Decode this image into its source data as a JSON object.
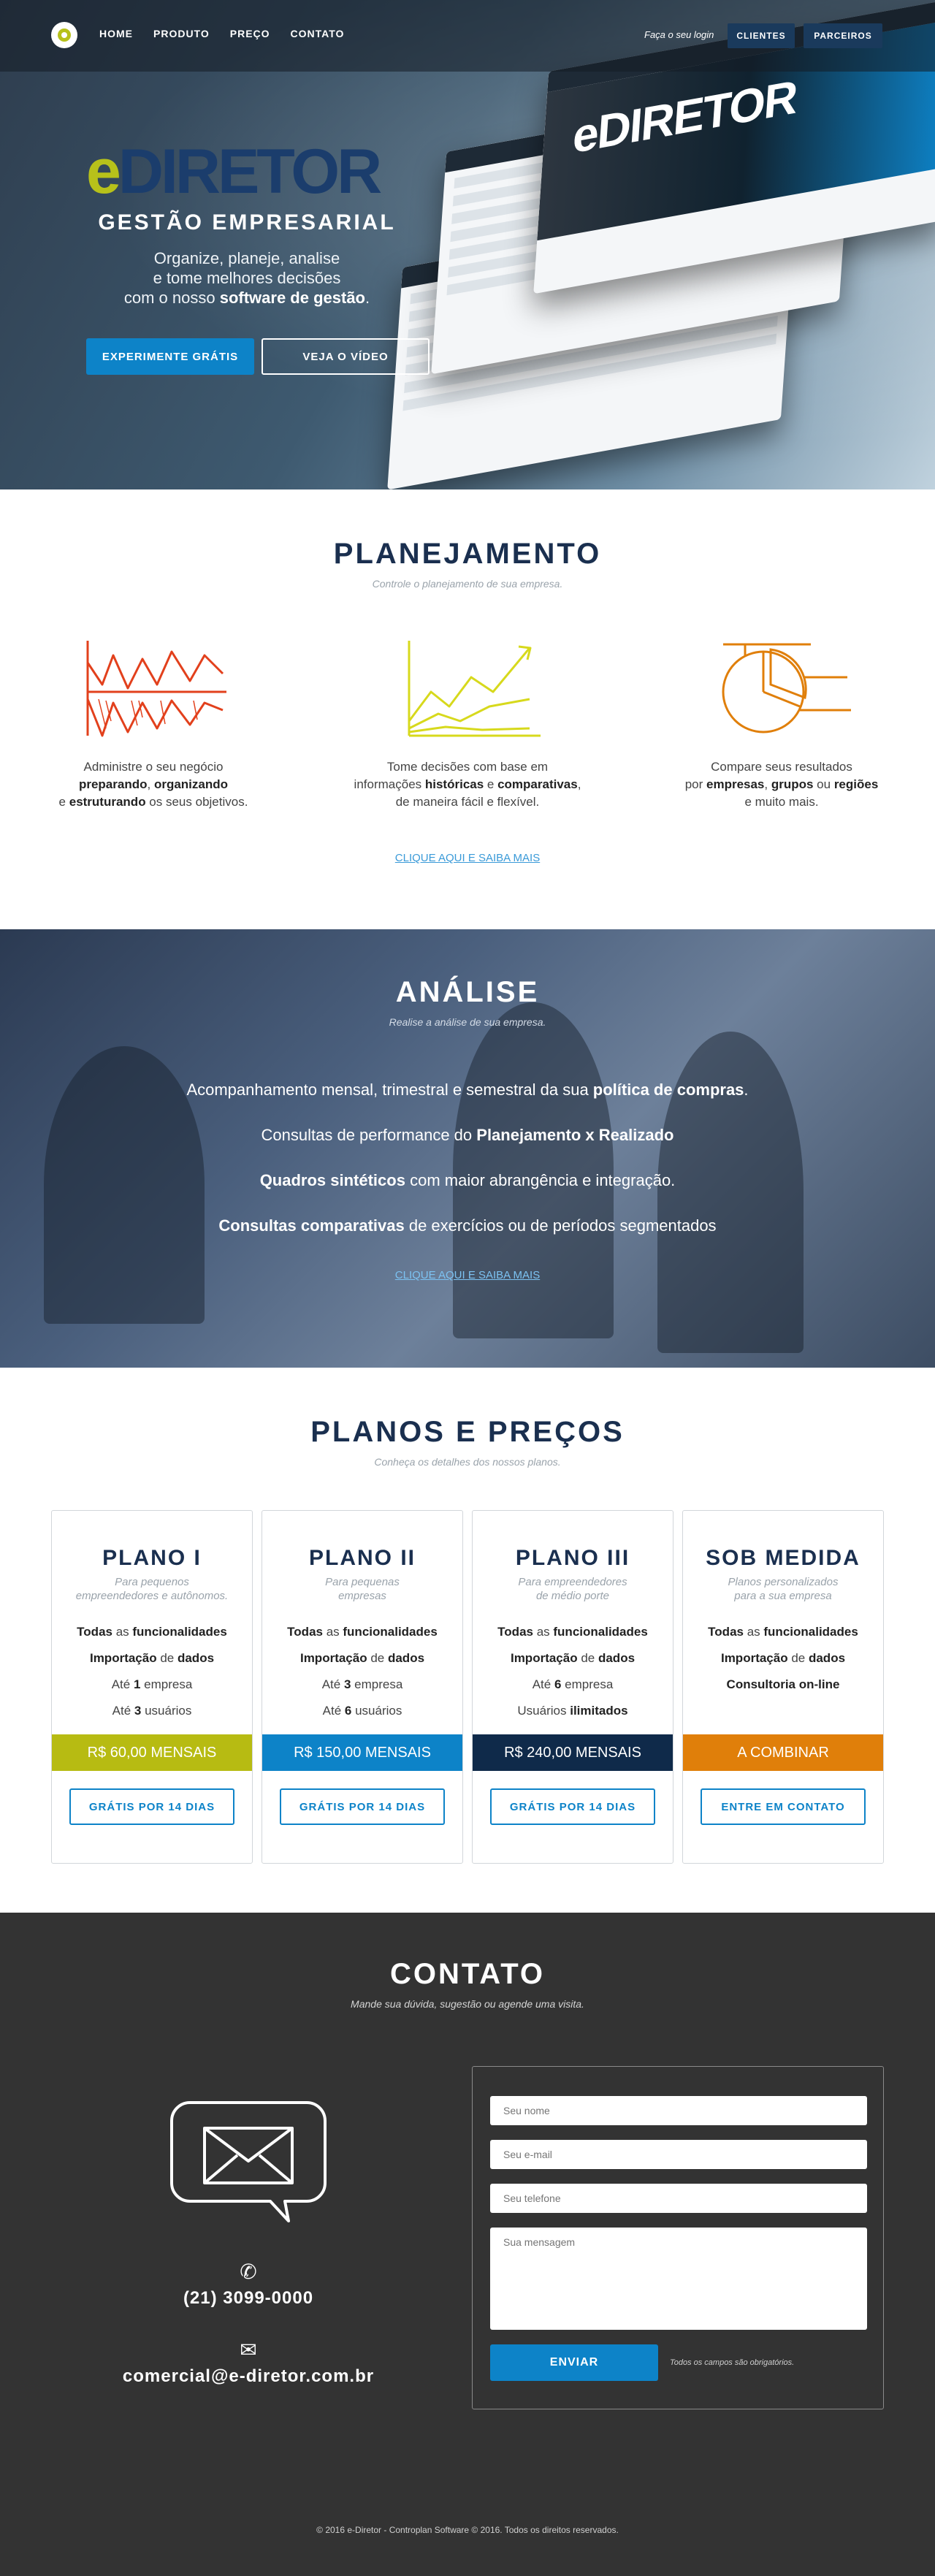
{
  "nav": {
    "items": [
      "HOME",
      "PRODUTO",
      "PREÇO",
      "CONTATO"
    ],
    "login_link": "Faça o seu login",
    "clientes": "CLIENTES",
    "parceiros": "PARCEIROS"
  },
  "hero": {
    "brand_e": "e",
    "brand_rest": "DIRETOR",
    "subtitle": "GESTÃO EMPRESARIAL",
    "line1": "Organize, planeje, analise",
    "line2": "e tome melhores decisões",
    "line3_pre": "com o nosso ",
    "line3_bold": "software de gestão",
    "line3_post": ".",
    "btn_primary": "EXPERIMENTE GRÁTIS",
    "btn_video": "VEJA O VÍDEO",
    "mockup_brand": "eDIRETOR"
  },
  "planejamento": {
    "title": "PLANEJAMENTO",
    "subtitle": "Controle o planejamento de sua empresa.",
    "features": [
      {
        "l1_pre": "Administre o seu negócio",
        "l2_b1": "preparando",
        "l2_mid": ", ",
        "l2_b2": "organizando",
        "l3_pre": "e ",
        "l3_b": "estruturando",
        "l3_post": " os seus objetivos."
      },
      {
        "l1_pre": "Tome decisões com base em",
        "l2_pre": "informações ",
        "l2_b1": "históricas",
        "l2_mid": " e ",
        "l2_b2": "comparativas",
        "l2_post": ",",
        "l3": "de maneira fácil e flexível."
      },
      {
        "l1_pre": "Compare seus resultados",
        "l2_pre": "por ",
        "l2_b1": "empresas",
        "l2_mid": ", ",
        "l2_b2": "grupos",
        "l2_mid2": " ou ",
        "l2_b3": "regiões",
        "l3": "e muito mais."
      }
    ],
    "link": "CLIQUE AQUI E SAIBA MAIS"
  },
  "analise": {
    "title": "ANÁLISE",
    "subtitle": "Realise a análise de sua empresa.",
    "l1_pre": "Acompanhamento mensal, trimestral e semestral da sua ",
    "l1_b": "política de compras",
    "l1_post": ".",
    "l2_pre": "Consultas de performance do ",
    "l2_b": "Planejamento x Realizado",
    "l3_b": "Quadros sintéticos",
    "l3_post": " com maior abrangência e integração.",
    "l4_b": "Consultas comparativas",
    "l4_post": " de exercícios ou de períodos segmentados",
    "link": "CLIQUE AQUI E SAIBA MAIS"
  },
  "planos": {
    "title": "PLANOS E PREÇOS",
    "subtitle": "Conheça os detalhes dos nossos planos.",
    "plans": [
      {
        "name": "PLANO I",
        "d1": "Para pequenos",
        "d2": "empreendedores e autônomos.",
        "price": "R$ 60,00 MENSAIS",
        "price_color": "#b7bb12",
        "button": "GRÁTIS POR 14 DIAS"
      },
      {
        "name": "PLANO II",
        "d1": "Para pequenas",
        "d2": "empresas",
        "price": "R$ 150,00 MENSAIS",
        "price_color": "#0d83c8",
        "button": "GRÁTIS POR 14 DIAS"
      },
      {
        "name": "PLANO III",
        "d1": "Para empreendedores",
        "d2": "de médio porte",
        "price": "R$ 240,00 MENSAIS",
        "price_color": "#0f2a4a",
        "button": "GRÁTIS POR 14 DIAS"
      },
      {
        "name": "SOB MEDIDA",
        "d1": "Planos personalizados",
        "d2": "para a sua empresa",
        "price": "A COMBINAR",
        "price_color": "#e07f0a",
        "button": "ENTRE EM CONTATO"
      }
    ],
    "f_todas": "Todas",
    "f_as": " as ",
    "f_func": "funcionalidades",
    "f_imp": "Importação",
    "f_de": " de ",
    "f_dados": "dados",
    "f_ate": "Até ",
    "p1_emp": "1",
    "p1_emp_t": " empresa",
    "p1_usr": "3",
    "p1_usr_t": " usuários",
    "p2_emp": "3",
    "p2_emp_t": " empresa",
    "p2_usr": "6",
    "p2_usr_t": " usuários",
    "p3_emp": "6",
    "p3_emp_t": " empresa",
    "p3_usr_pre": "Usuários ",
    "p3_usr_b": "ilimitados",
    "p4_consult": "Consultoria on-line"
  },
  "contato": {
    "title": "CONTATO",
    "subtitle": "Mande sua dúvida, sugestão ou agende uma visita.",
    "phone": "(21) 3099-0000",
    "email": "comercial@e-diretor.com.br",
    "ph_name": "Seu nome",
    "ph_email": "Seu e-mail",
    "ph_phone": "Seu telefone",
    "ph_message": "Sua mensagem",
    "send": "ENVIAR",
    "note": "Todos os campos são obrigatórios.",
    "footer": "© 2016 e-Diretor - Controplan Software © 2016. Todos os direitos reservados."
  }
}
